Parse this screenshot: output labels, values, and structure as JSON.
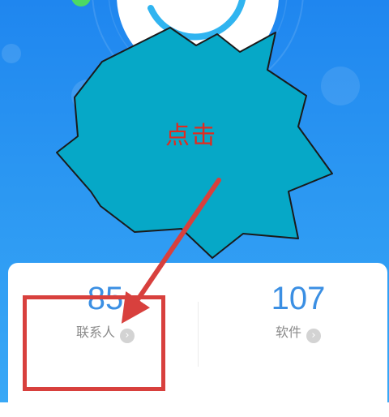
{
  "stats": [
    {
      "value": "85",
      "label": "联系人"
    },
    {
      "value": "107",
      "label": "软件"
    }
  ],
  "callout": {
    "text": "点击"
  },
  "colors": {
    "header_blue": "#2a92f0",
    "stat_value": "#3b8fe3",
    "annotation_red": "#d8403d",
    "callout_fill": "#06a8c7"
  },
  "icons": {
    "chevron": "chevron-right-icon"
  }
}
